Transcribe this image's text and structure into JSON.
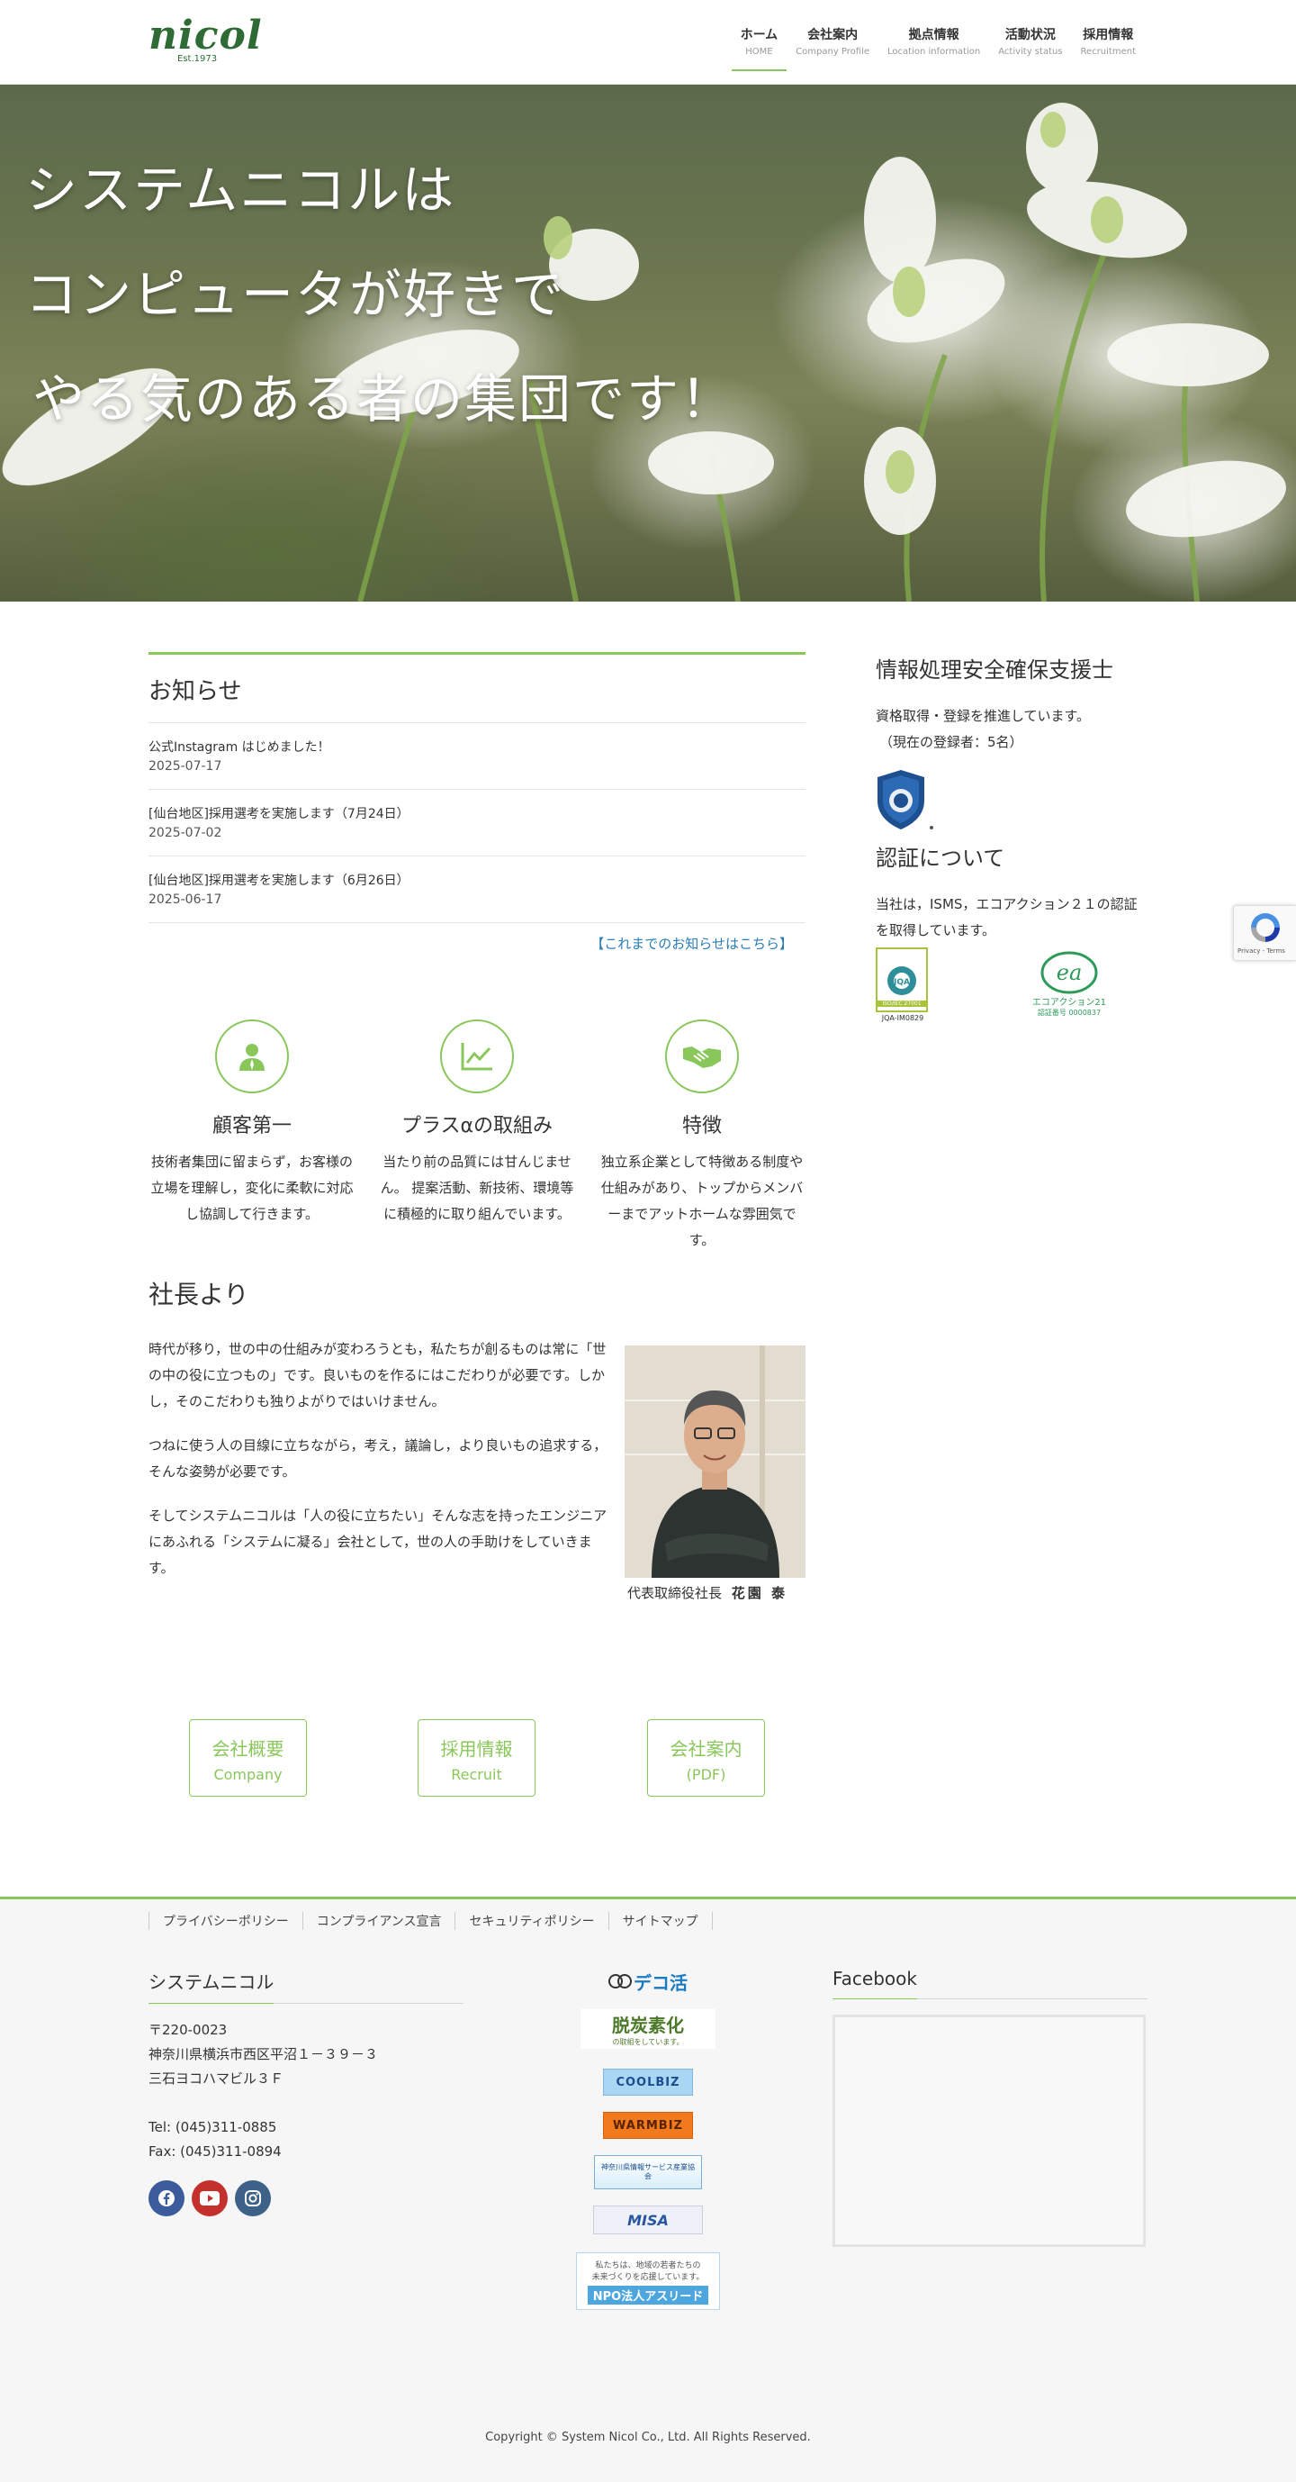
{
  "header": {
    "logo_text": "nicol",
    "logo_est": "Est.1973",
    "nav": [
      {
        "jp": "ホーム",
        "en": "HOME"
      },
      {
        "jp": "会社案内",
        "en": "Company Profile"
      },
      {
        "jp": "拠点情報",
        "en": "Location information"
      },
      {
        "jp": "活動状況",
        "en": "Activity status"
      },
      {
        "jp": "採用情報",
        "en": "Recruitment"
      }
    ]
  },
  "hero": {
    "line1": "システムニコルは",
    "line2": "コンピュータが好きで",
    "line3": "やる気のある者の集団です！"
  },
  "news": {
    "title": "お知らせ",
    "items": [
      {
        "title": "公式Instagram はじめました！",
        "date": "2025-07-17"
      },
      {
        "title": "[仙台地区]採用選考を実施します（7月24日）",
        "date": "2025-07-02"
      },
      {
        "title": "[仙台地区]採用選考を実施します（6月26日）",
        "date": "2025-06-17"
      }
    ],
    "more": "【これまでのお知らせはこちら】"
  },
  "features": [
    {
      "icon": "person-icon",
      "title": "顧客第一",
      "desc": "技術者集団に留まらず，お客様の立場を理解し，変化に柔軟に対応し協調して行きます。"
    },
    {
      "icon": "chart-icon",
      "title": "プラスαの取組み",
      "desc": "当たり前の品質には甘んじません。 提案活動、新技術、環境等に積極的に取り組んでいます。"
    },
    {
      "icon": "handshake-icon",
      "title": "特徴",
      "desc": "独立系企業として特徴ある制度や仕組みがあり、トップからメンバーまでアットホームな雰囲気です。"
    }
  ],
  "ceo": {
    "title": "社長より",
    "p1": "時代が移り，世の中の仕組みが変わろうとも，私たちが創るものは常に「世の中の役に立つもの」です。良いものを作るにはこだわりが必要です。しかし，そのこだわりも独りよがりではいけません。",
    "p2": "つねに使う人の目線に立ちながら，考え，議論し，より良いもの追求する，そんな姿勢が必要です。",
    "p3": "そしてシステムニコルは「人の役に立ちたい」そんな志を持ったエンジニアにあふれる「システムに凝る」会社として，世の人の手助けをしていきます。",
    "caption_role": "代表取締役社長",
    "caption_name": "花園 泰"
  },
  "sidebar": {
    "h1": "情報処理安全確保支援士",
    "p1a": "資格取得・登録を推進しています。",
    "p1b": "（現在の登録者：5名）",
    "h2": "認証について",
    "p2": "当社は，ISMS，エコアクション２１の認証を取得しています。",
    "isms_label": "JQA-IM0829",
    "isms_code": "ISO/IEC 27001",
    "ea_label": "エコアクション21",
    "ea_code": "認証番号 0000837"
  },
  "buttons": [
    {
      "l1": "会社概要",
      "l2": "Company"
    },
    {
      "l1": "採用情報",
      "l2": "Recruit"
    },
    {
      "l1": "会社案内",
      "l2": "(PDF)"
    }
  ],
  "footer": {
    "links": [
      "プライバシーポリシー",
      "コンプライアンス宣言",
      "セキュリティポリシー",
      "サイトマップ"
    ],
    "company": "システムニコル",
    "postal": "〒220-0023",
    "addr1": "神奈川県横浜市西区平沼１－３９－３",
    "addr2": "三石ヨコハマビル３Ｆ",
    "tel": "Tel: (045)311-0885",
    "fax": "Fax: (045)311-0894",
    "facebook": "Facebook",
    "banners": {
      "deco": "デコ活",
      "datsutanso": "脱炭素化",
      "datsutanso_sub": "の取組をしています。",
      "coolbiz": "COOLBIZ",
      "warmbiz": "WARMBIZ",
      "kanagawa": "神奈川県情報サービス産業協会",
      "miya": "MISA",
      "npo1": "私たちは、地域の若者たちの",
      "npo2": "未来づくりを応援しています。",
      "npo3": "NPO法人アスリード"
    },
    "copyright": "Copyright © System Nicol Co., Ltd. All Rights Reserved."
  },
  "recaptcha": "Privacy - Terms",
  "colors": {
    "accent": "#8ac75b",
    "link": "#2a7db5",
    "logo": "#2e6b35"
  }
}
